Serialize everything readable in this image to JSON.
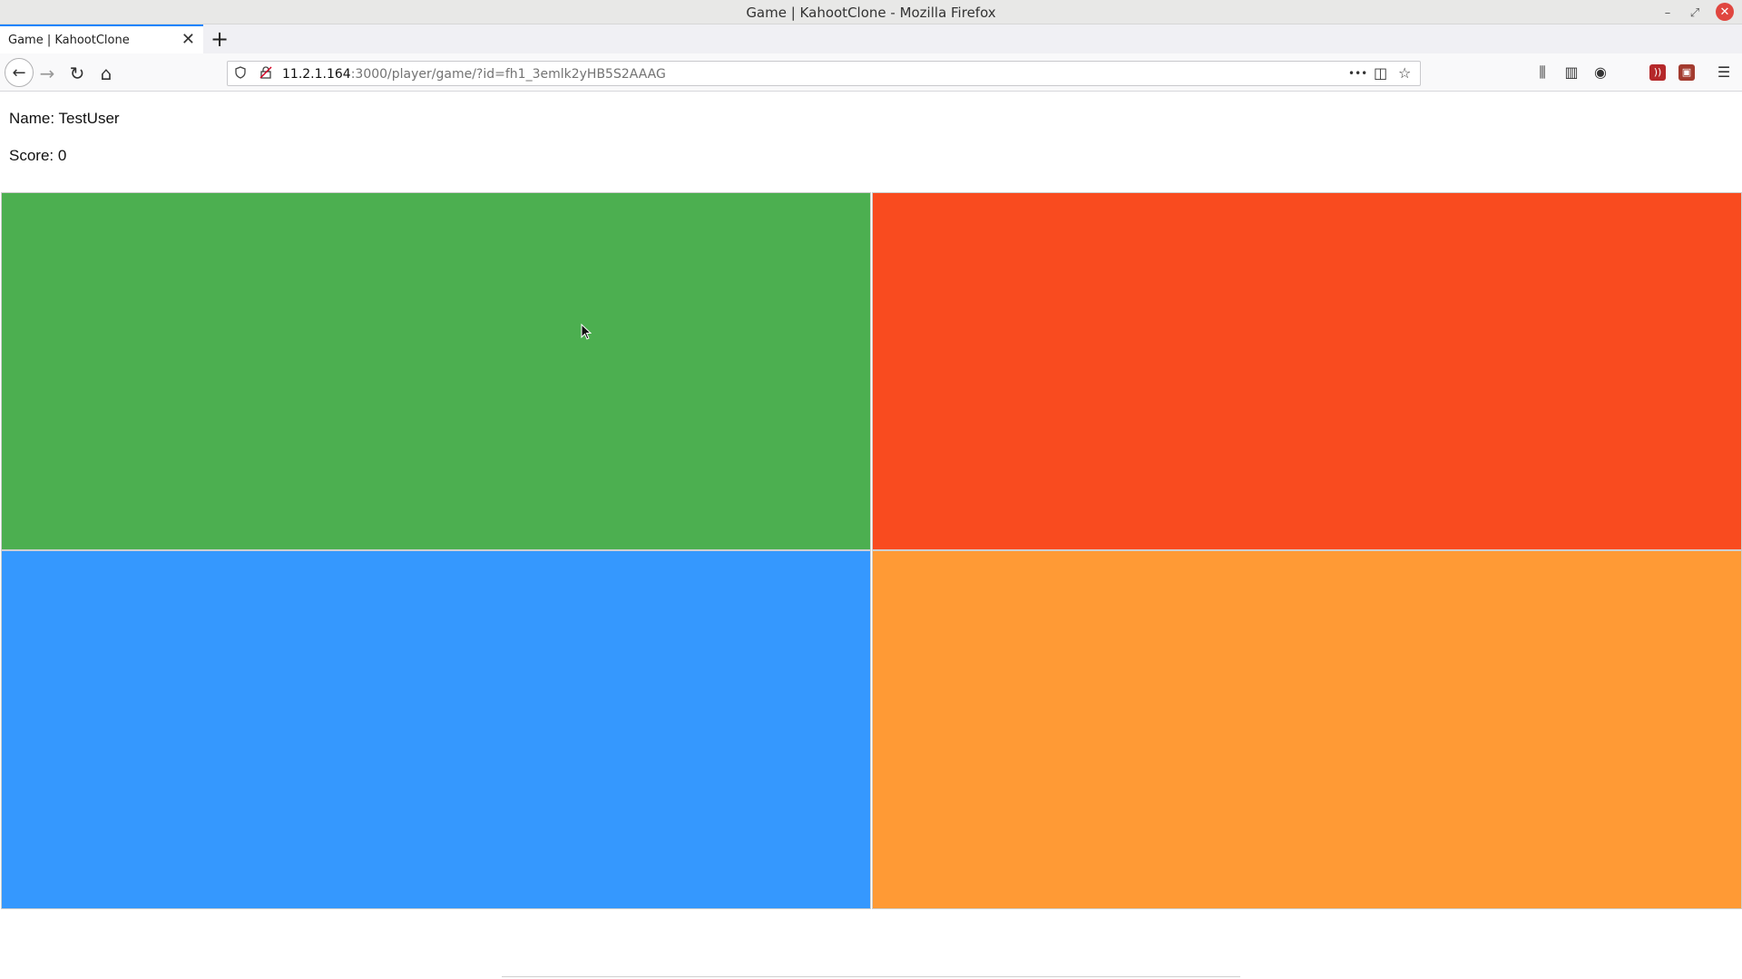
{
  "window": {
    "title": "Game | KahootClone - Mozilla Firefox",
    "minimize_glyph": "–",
    "restore_glyph": "⤢",
    "close_glyph": "✕"
  },
  "tabs": [
    {
      "label": "Game | KahootClone",
      "close_glyph": "✕"
    }
  ],
  "newtab_glyph": "+",
  "nav": {
    "back_glyph": "←",
    "forward_glyph": "→",
    "reload_glyph": "↻",
    "home_glyph": "⌂",
    "url_host": "11.2.1.164",
    "url_rest": ":3000/player/game/?id=fh1_3emlk2yHB5S2AAAG",
    "page_actions_glyph": "•••",
    "pocket_glyph": "◫",
    "bookmark_glyph": "☆",
    "library_glyph": "⫼",
    "sidebar_glyph": "▥",
    "account_glyph": "◉",
    "rss_glyph": "))",
    "ext_glyph": "▣",
    "menu_glyph": "☰"
  },
  "player": {
    "name_label": "Name: TestUser",
    "score_label": "Score: 0"
  },
  "answers": [
    {
      "color": "#4caf50"
    },
    {
      "color": "#f94b1f"
    },
    {
      "color": "#3598fe"
    },
    {
      "color": "#ff9a35"
    }
  ]
}
